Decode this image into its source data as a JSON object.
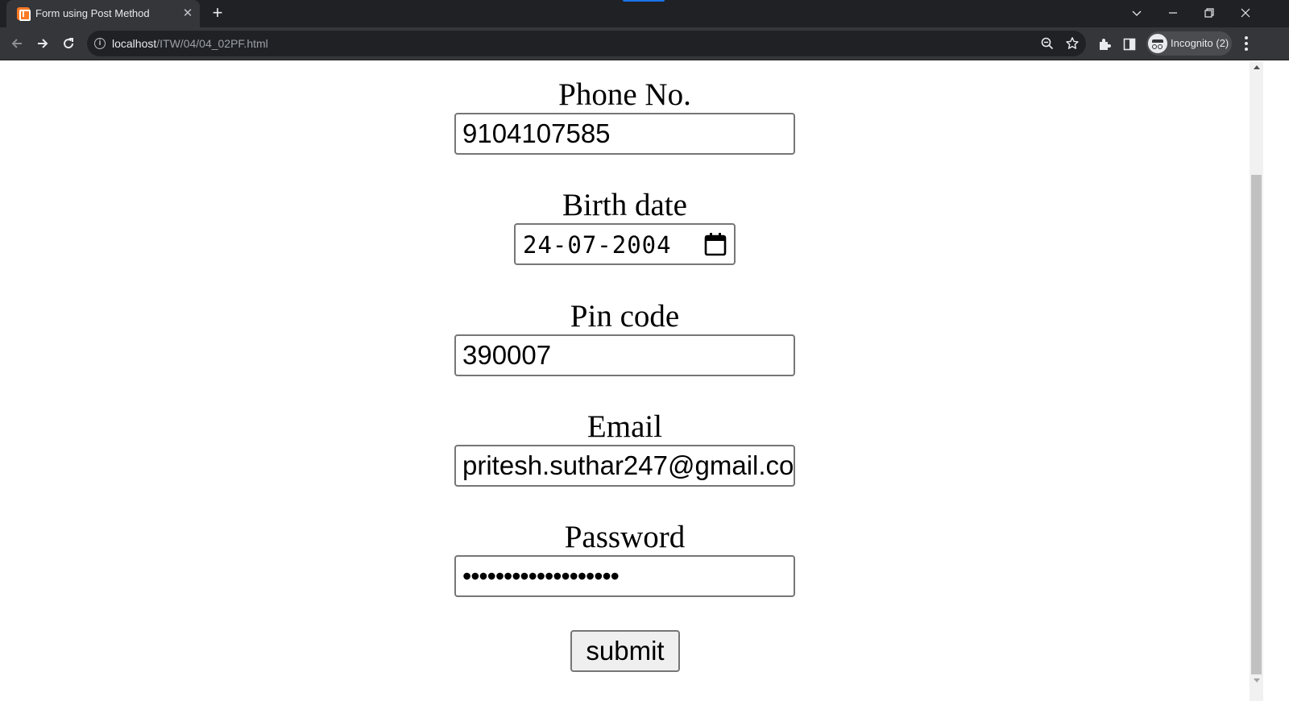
{
  "browser": {
    "tab_title": "Form using Post Method",
    "tab_close_icon": "close-icon",
    "new_tab_icon": "plus-icon",
    "url_host": "localhost",
    "url_path": "/ITW/04/04_02PF.html",
    "profile_label": "Incognito (2)"
  },
  "form": {
    "phone": {
      "label": "Phone No.",
      "value": "9104107585"
    },
    "birth": {
      "label": "Birth date",
      "value": "24-07-2004"
    },
    "pin": {
      "label": "Pin code",
      "value": "390007"
    },
    "email": {
      "label": "Email",
      "value": "pritesh.suthar247@gmail.co"
    },
    "password": {
      "label": "Password",
      "value": "•••••••••••••••••••"
    },
    "submit_label": "submit"
  }
}
